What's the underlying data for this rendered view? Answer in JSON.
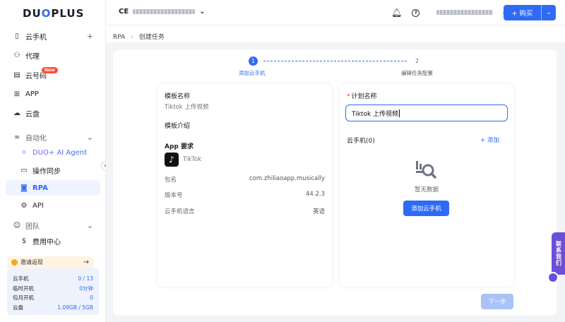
{
  "brand": {
    "logo_text_a": "DU",
    "logo_text_o": "O",
    "logo_text_b": "PLUS"
  },
  "sidebar": {
    "items": [
      {
        "label": "云手机",
        "icon": "phone-icon",
        "right": "+"
      },
      {
        "label": "代理",
        "icon": "proxy-icon"
      },
      {
        "label": "云号码",
        "icon": "sim-icon",
        "badge": "New"
      },
      {
        "label": "APP",
        "icon": "grid-icon"
      },
      {
        "label": "云盘",
        "icon": "cloud-icon"
      },
      {
        "label": "自动化",
        "icon": "infinity-icon",
        "right": "⌄"
      },
      {
        "label": "DUO+ AI Agent",
        "icon": "ai-agent-icon"
      },
      {
        "label": "操作同步",
        "icon": "sync-icon"
      },
      {
        "label": "RPA",
        "icon": "robot-icon"
      },
      {
        "label": "API",
        "icon": "api-icon"
      },
      {
        "label": "团队",
        "icon": "team-icon",
        "right": "⌄"
      },
      {
        "label": "费用中心",
        "icon": "dollar-icon"
      }
    ],
    "invite": {
      "label": "邀请返现",
      "arrow": "→"
    },
    "stats": [
      {
        "label": "云手机",
        "value": "0 / 13"
      },
      {
        "label": "临时开机",
        "value": "0分钟"
      },
      {
        "label": "包月开机",
        "value": "0"
      },
      {
        "label": "云盘",
        "value": "1.09GB / 5GB"
      }
    ]
  },
  "topbar": {
    "account_initials": "CE",
    "buy_label": "+ 购买"
  },
  "breadcrumb": {
    "root": "RPA",
    "current": "创建任务"
  },
  "steps": [
    {
      "num": "1",
      "label": "添加云手机"
    },
    {
      "num": "2",
      "label": "编辑任务配置"
    }
  ],
  "template": {
    "name_label": "模板名称",
    "name_value": "Tiktok 上传视频",
    "intro_label": "模板介绍",
    "app_req_label": "App 要求",
    "app_name": "TikTok",
    "rows": [
      {
        "key": "包名",
        "value": "com.zhiliaoapp.musically"
      },
      {
        "key": "版本号",
        "value": "44.2.3"
      },
      {
        "key": "云手机语言",
        "value": "英语"
      }
    ]
  },
  "plan": {
    "required_mark": "*",
    "name_label": "计划名称",
    "name_value": "Tiktok 上传视频",
    "phones_label": "云手机(0)",
    "add_label": "+ 添加",
    "empty_text": "暂无数据",
    "add_phone_button": "添加云手机"
  },
  "footer": {
    "next_label": "下一步"
  },
  "contact": {
    "label": "联系我们"
  },
  "colors": {
    "accent": "#2e6bf5",
    "contact": "#6b4fd8",
    "badge": "#ff4d3a"
  }
}
